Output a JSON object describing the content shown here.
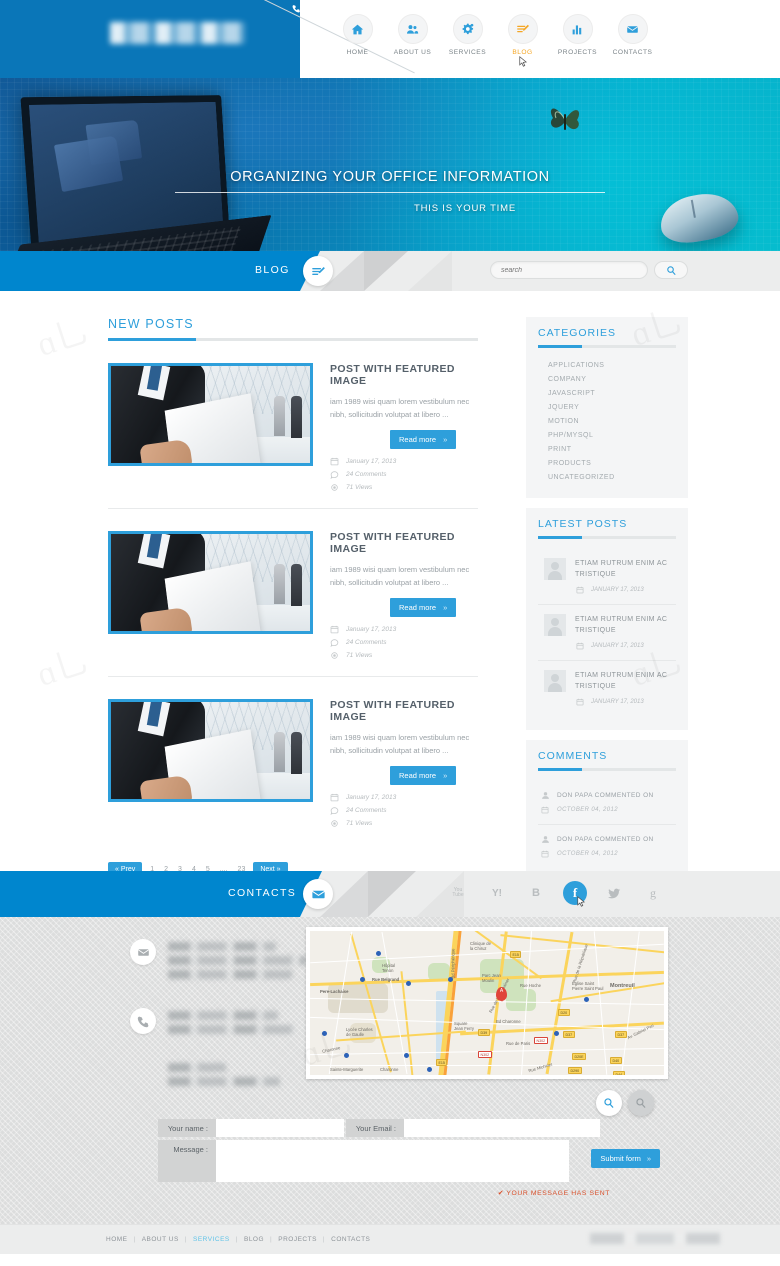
{
  "brand": {
    "accent": "#2e9fdb",
    "accent_dark": "#0086ce",
    "highlight": "#f5a623"
  },
  "header": {
    "nav": [
      {
        "label": "HOME",
        "icon": "home-icon",
        "active": false
      },
      {
        "label": "ABOUT US",
        "icon": "users-icon",
        "active": false
      },
      {
        "label": "SERVICES",
        "icon": "gear-icon",
        "active": false
      },
      {
        "label": "BLOG",
        "icon": "pencil-lines-icon",
        "active": true
      },
      {
        "label": "PROJECTS",
        "icon": "bar-chart-icon",
        "active": false
      },
      {
        "label": "CONTACTS",
        "icon": "envelope-icon",
        "active": false
      }
    ]
  },
  "hero": {
    "title": "ORGANIZING YOUR OFFICE INFORMATION",
    "subtitle": "THIS IS YOUR TIME"
  },
  "titlebar": {
    "label": "BLOG",
    "icon": "pencil-lines-icon",
    "search_placeholder": "search",
    "search_value": "",
    "search_button_icon": "search-icon"
  },
  "main": {
    "section_title": "NEW POSTS",
    "posts": [
      {
        "title": "POST WITH FEATURED IMAGE",
        "excerpt": "iam 1989 wisi quam lorem vestibulum nec nibh, sollicitudin volutpat at libero ...",
        "read_more": "Read more",
        "date": "January 17, 2013",
        "comments": "24 Comments",
        "views": "71 Views"
      },
      {
        "title": "POST WITH FEATURED IMAGE",
        "excerpt": "iam 1989 wisi quam lorem vestibulum nec nibh, sollicitudin volutpat at libero ...",
        "read_more": "Read more",
        "date": "January 17, 2013",
        "comments": "24 Comments",
        "views": "71 Views"
      },
      {
        "title": "POST WITH FEATURED IMAGE",
        "excerpt": "iam 1989 wisi quam lorem vestibulum nec nibh, sollicitudin volutpat at libero ...",
        "read_more": "Read more",
        "date": "January 17, 2013",
        "comments": "24 Comments",
        "views": "71 Views"
      }
    ],
    "pagination": {
      "prev": "« Prev",
      "pages": [
        "1",
        "2",
        "3",
        "4",
        "5",
        "....",
        "23"
      ],
      "next": "Next »"
    }
  },
  "sidebar": {
    "categories": {
      "title": "CATEGORIES",
      "items": [
        "APPLICATIONS",
        "COMPANY",
        "JAVASCRIPT",
        "JQUERY",
        "MOTION",
        "PHP/MYSQL",
        "PRINT",
        "PRODUCTS",
        "UNCATEGORIZED"
      ]
    },
    "latest_posts": {
      "title": "LATEST POSTS",
      "items": [
        {
          "title": "ETIAM RUTRUM ENIM AC TRISTIQUE",
          "date": "JANUARY 17, 2013"
        },
        {
          "title": "ETIAM RUTRUM ENIM AC TRISTIQUE",
          "date": "JANUARY 17, 2013"
        },
        {
          "title": "ETIAM RUTRUM ENIM AC TRISTIQUE",
          "date": "JANUARY 17, 2013"
        }
      ]
    },
    "comments": {
      "title": "COMMENTS",
      "items": [
        {
          "author": "DON PAPA COMMENTED ON",
          "date": "OCTOBER 04, 2012"
        },
        {
          "author": "DON PAPA COMMENTED ON",
          "date": "OCTOBER 04, 2012"
        }
      ]
    }
  },
  "contacts_bar": {
    "label": "CONTACTS",
    "icon": "envelope-icon",
    "socials": [
      {
        "name": "youtube-icon",
        "glyph": "You\nTube",
        "active": false
      },
      {
        "name": "yahoo-icon",
        "glyph": "Y!",
        "active": false
      },
      {
        "name": "blogger-icon",
        "glyph": "B",
        "active": false
      },
      {
        "name": "facebook-icon",
        "glyph": "f",
        "active": true
      },
      {
        "name": "twitter-icon",
        "glyph": "t",
        "active": false
      },
      {
        "name": "google-icon",
        "glyph": "g",
        "active": false
      }
    ]
  },
  "contact_section": {
    "email_icon": "envelope-icon",
    "phone_icon": "phone-icon",
    "map": {
      "marker": "A",
      "labels": [
        "Pere-Lachaise",
        "Rue Belgrand",
        "Montreuil",
        "Hôpital Tenon",
        "Clinique de la Chiruz",
        "Parc Jean Moulin",
        "Rue Hoche",
        "Eglise Saint Pierre Saint Paul",
        "Bd Charonne",
        "Rue de Paris",
        "Square Jean Ferry",
        "Lycée Charles de Gaulle",
        "Sainte-Marguerite",
        "Charonne",
        "Bd de Belleville",
        "Av. Gabriel Peri",
        "Rue Michelet",
        "Rue de la République",
        "Bd Périphérique"
      ],
      "shields": [
        "D38",
        "D20",
        "D37",
        "D37",
        "N302",
        "N302",
        "D20E",
        "D40",
        "D290",
        "D44",
        "E15",
        "E15"
      ],
      "zoom_in_icon": "zoom-in-icon",
      "zoom_out_icon": "zoom-out-icon"
    },
    "form": {
      "name_label": "Your name :",
      "name_value": "",
      "email_label": "Your Email :",
      "email_value": "",
      "message_label": "Message :",
      "message_value": "",
      "submit_label": "Submit form",
      "status": "✔ YOUR MESSAGE HAS SENT"
    }
  },
  "footer": {
    "nav": [
      "HOME",
      "ABOUT US",
      "SERVICES",
      "BLOG",
      "PROJECTS",
      "CONTACTS"
    ],
    "active": "SERVICES"
  }
}
